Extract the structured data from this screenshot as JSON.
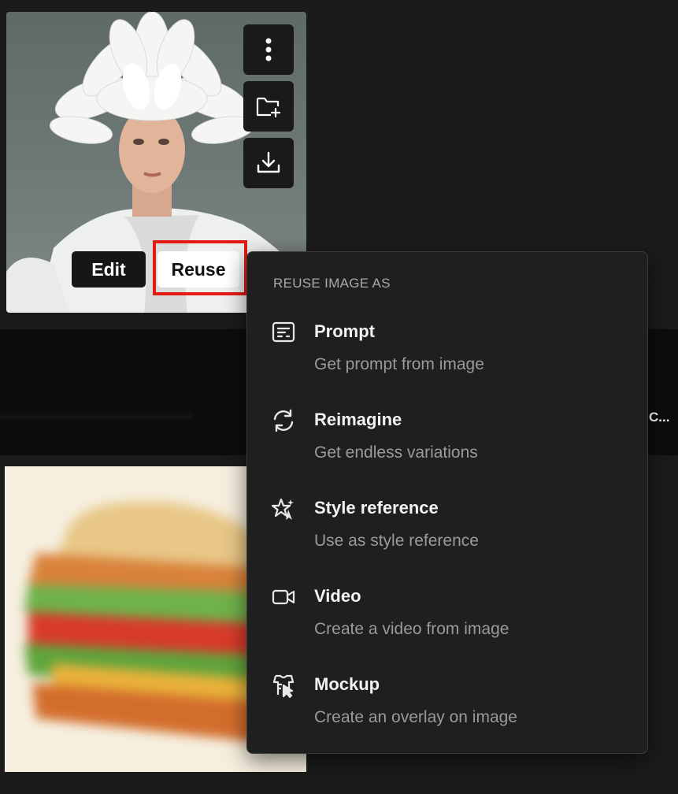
{
  "card": {
    "edit_label": "Edit",
    "reuse_label": "Reuse",
    "icons": [
      "more-vertical-icon",
      "folder-plus-icon",
      "download-icon"
    ]
  },
  "side_text": "C...",
  "menu": {
    "heading": "REUSE IMAGE AS",
    "items": [
      {
        "icon": "prompt-icon",
        "title": "Prompt",
        "subtitle": "Get prompt from image"
      },
      {
        "icon": "refresh-icon",
        "title": "Reimagine",
        "subtitle": "Get endless variations"
      },
      {
        "icon": "sparkle-star-icon",
        "title": "Style reference",
        "subtitle": "Use as style reference"
      },
      {
        "icon": "video-camera-icon",
        "title": "Video",
        "subtitle": "Create a video from image"
      },
      {
        "icon": "mockup-icon",
        "title": "Mockup",
        "subtitle": "Create an overlay on image"
      }
    ]
  },
  "colors": {
    "background": "#1b1b1b",
    "menu_bg": "#1f1f1f",
    "highlight": "#e31b12"
  }
}
